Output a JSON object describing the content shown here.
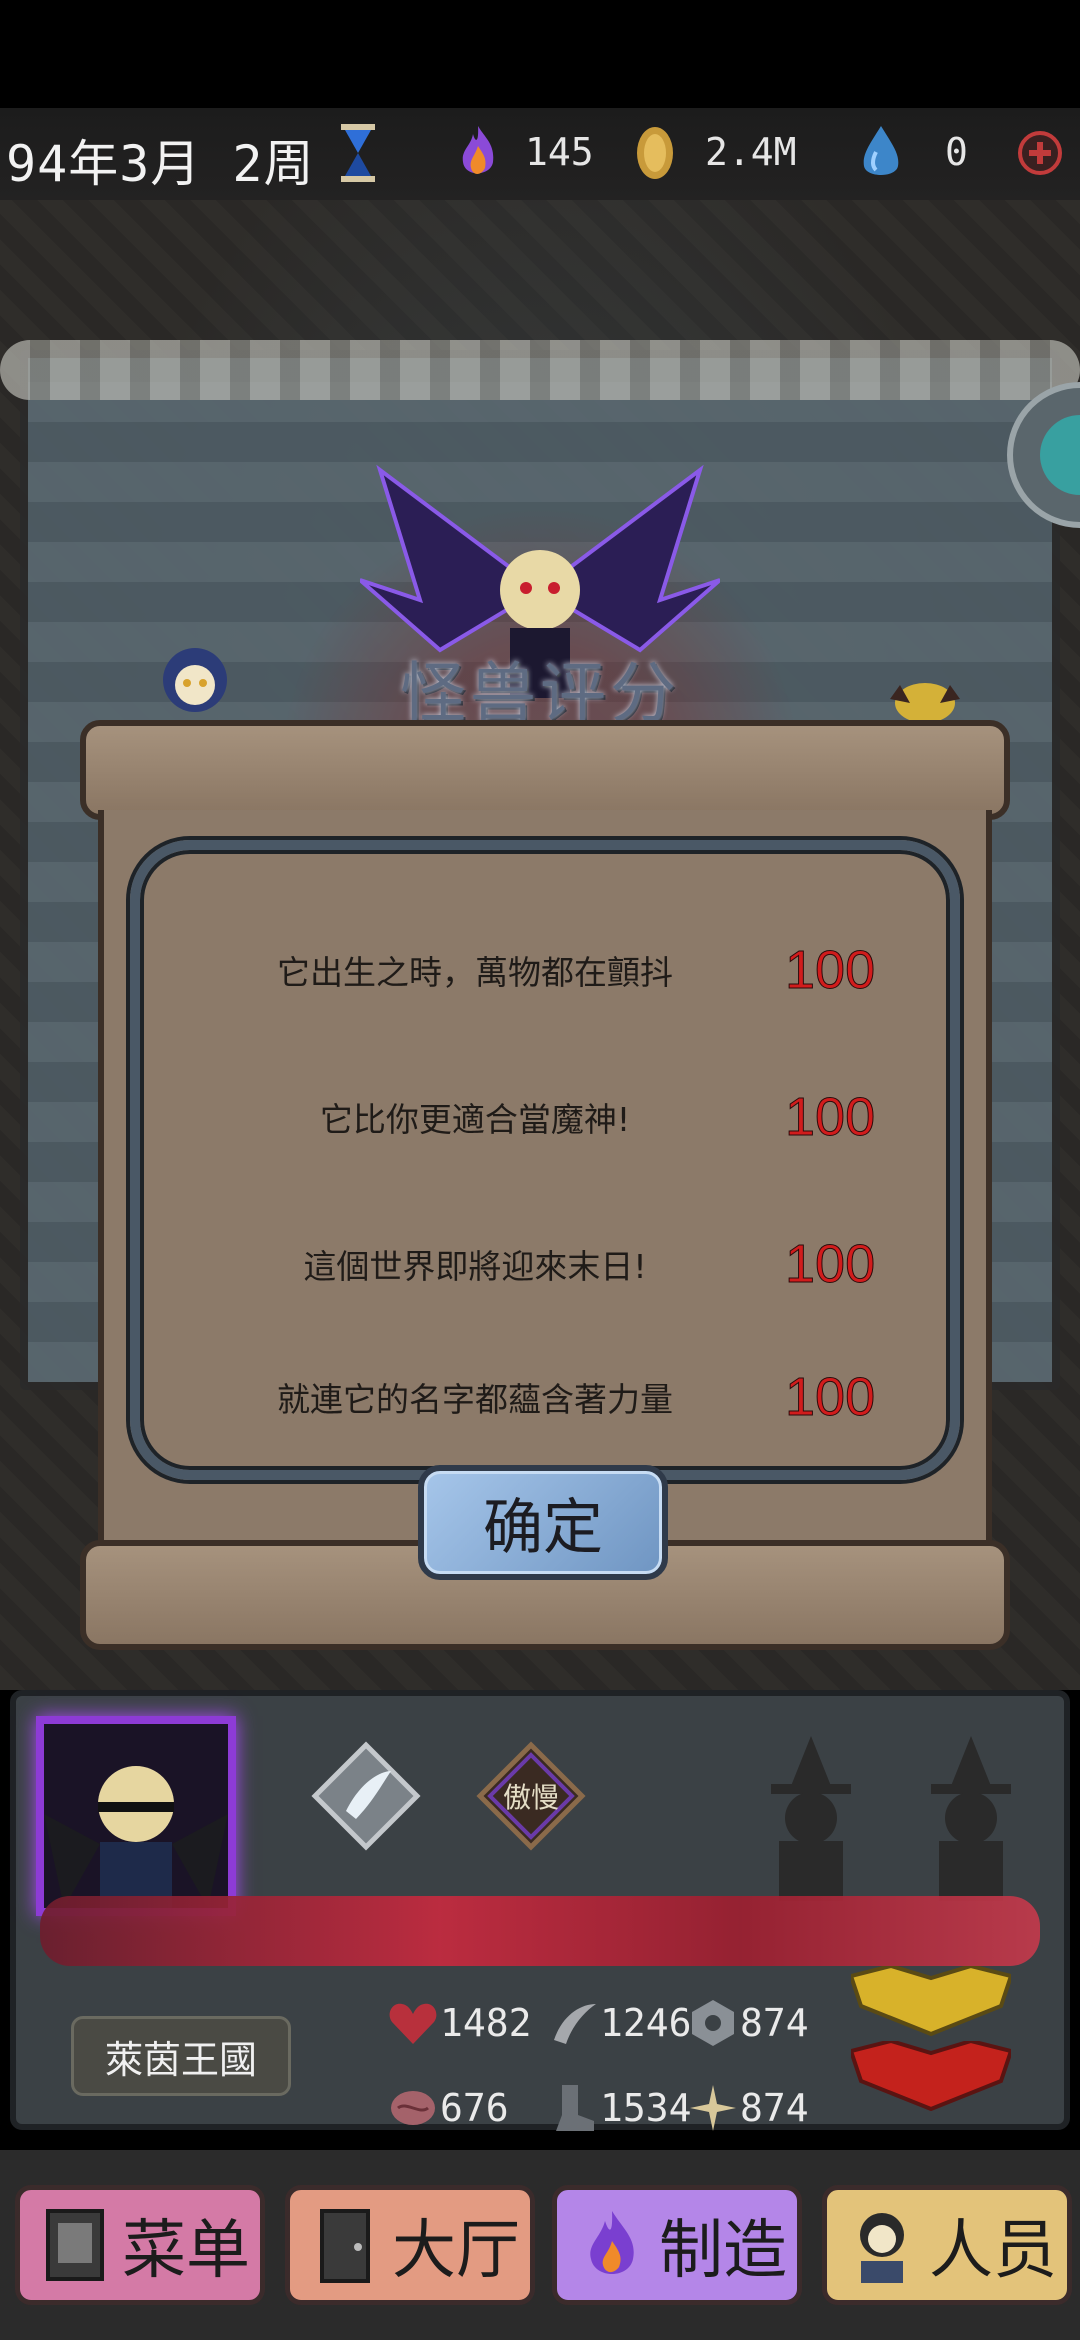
{
  "hud": {
    "date": "94年3月 2周",
    "fire_value": "145",
    "coin_value": "2.4M",
    "water_value": "0"
  },
  "dialog": {
    "title": "怪兽评分",
    "rows": [
      {
        "label": "它出生之時，萬物都在顫抖",
        "score": "100"
      },
      {
        "label": "它比你更適合當魔神!",
        "score": "100"
      },
      {
        "label": "這個世界即將迎來末日!",
        "score": "100"
      },
      {
        "label": "就連它的名字都蘊含著力量",
        "score": "100"
      }
    ],
    "confirm_label": "确定"
  },
  "character": {
    "trait": "傲慢",
    "kingdom": "萊茵王國",
    "stats": {
      "health": "1482",
      "attack": "1246",
      "defense": "874",
      "intellect": "676",
      "speed": "1534",
      "magic": "874"
    }
  },
  "nav": {
    "menu": "菜单",
    "hall": "大厅",
    "craft": "制造",
    "staff": "人员"
  },
  "colors": {
    "score_red": "#d11c1c",
    "portrait_border": "#8d3bd6",
    "confirm_button": "#8fb2da"
  }
}
